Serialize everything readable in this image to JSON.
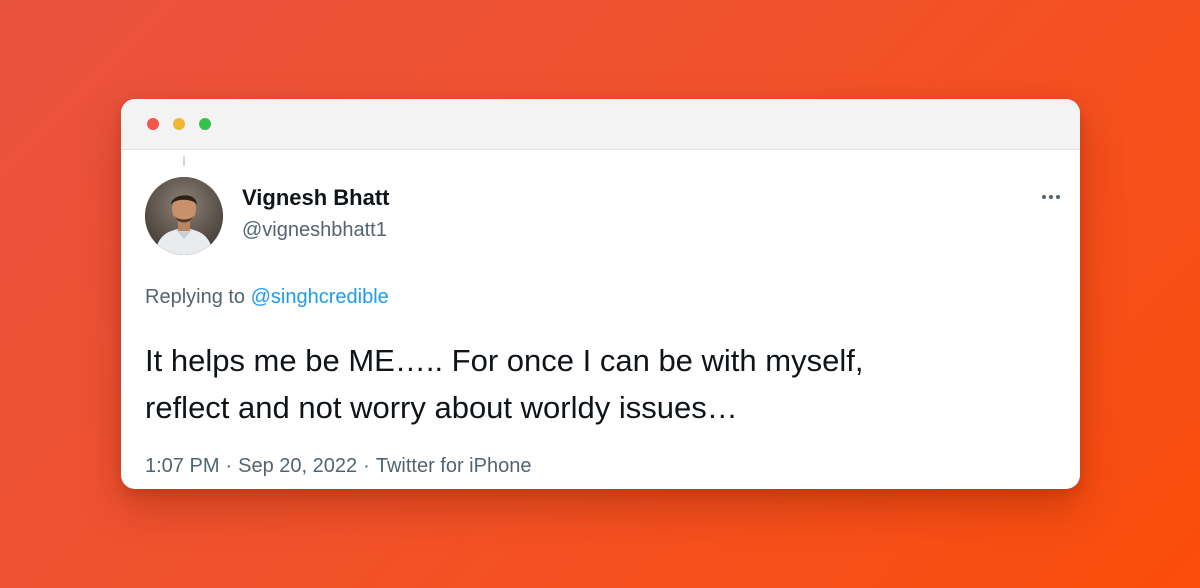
{
  "window": {
    "controls": [
      "close",
      "minimize",
      "maximize"
    ]
  },
  "tweet": {
    "author": {
      "name": "Vignesh Bhatt",
      "handle": "@vigneshbhatt1",
      "avatar_icon": "profile-photo"
    },
    "more_icon": "ellipsis-icon",
    "replying": {
      "prefix": "Replying to",
      "mention": "@singhcredible"
    },
    "text_lines": [
      "It helps me be ME….. For once I can be with myself,",
      "reflect and not worry about worldy issues…"
    ],
    "meta": {
      "time": "1:07 PM",
      "separator": "·",
      "date": "Sep 20, 2022",
      "source": "Twitter for iPhone"
    }
  },
  "colors": {
    "background_start": "#ea5240",
    "background_end": "#fb4d0b",
    "link": "#1d9bf0",
    "text_primary": "#0f1419",
    "text_secondary": "#536471"
  }
}
